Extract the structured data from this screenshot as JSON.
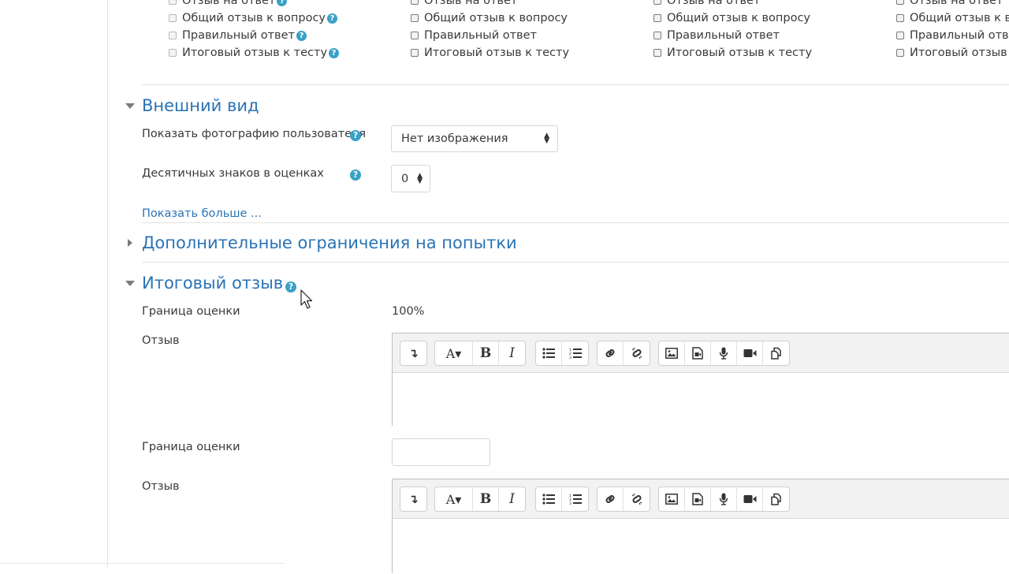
{
  "review_options": {
    "columns": [
      {
        "items": [
          {
            "label": "Отзыв на ответ",
            "help": true
          },
          {
            "label": "Общий отзыв к вопросу",
            "help": true
          },
          {
            "label": "Правильный ответ",
            "help": true
          },
          {
            "label": "Итоговый отзыв к тесту",
            "help": true
          }
        ]
      },
      {
        "items": [
          {
            "label": "Отзыв на ответ"
          },
          {
            "label": "Общий отзыв к вопросу"
          },
          {
            "label": "Правильный ответ"
          },
          {
            "label": "Итоговый отзыв к тесту"
          }
        ]
      },
      {
        "items": [
          {
            "label": "Отзыв на ответ"
          },
          {
            "label": "Общий отзыв к вопросу"
          },
          {
            "label": "Правильный ответ"
          },
          {
            "label": "Итоговый отзыв к тесту"
          }
        ]
      },
      {
        "items": [
          {
            "label": "Отзыв на ответ"
          },
          {
            "label": "Общий отзыв к вопросу"
          },
          {
            "label": "Правильный ответ"
          },
          {
            "label": "Итоговый отзыв к тесту"
          }
        ]
      }
    ]
  },
  "appearance": {
    "title": "Внешний вид",
    "show_user_photo_label": "Показать фотографию пользователя",
    "show_user_photo_value": "Нет изображения",
    "decimal_places_label": "Десятичных знаков в оценках",
    "decimal_places_value": "0",
    "show_more": "Показать больше ..."
  },
  "extra_restrictions": {
    "title": "Дополнительные ограничения на попытки"
  },
  "overall_feedback": {
    "title": "Итоговый отзыв",
    "grade_boundary_label_1": "Граница оценки",
    "grade_boundary_value_1": "100%",
    "feedback_label_1": "Отзыв",
    "grade_boundary_label_2": "Граница оценки",
    "grade_boundary_input_2": "",
    "feedback_label_2": "Отзыв"
  },
  "help_glyph": "?",
  "toolbar_glyphs": {
    "toggle": "↴",
    "font": "A▾",
    "bold": "B",
    "italic": "I"
  },
  "colors": {
    "accent": "#2a73b5",
    "help": "#39a1c6"
  }
}
